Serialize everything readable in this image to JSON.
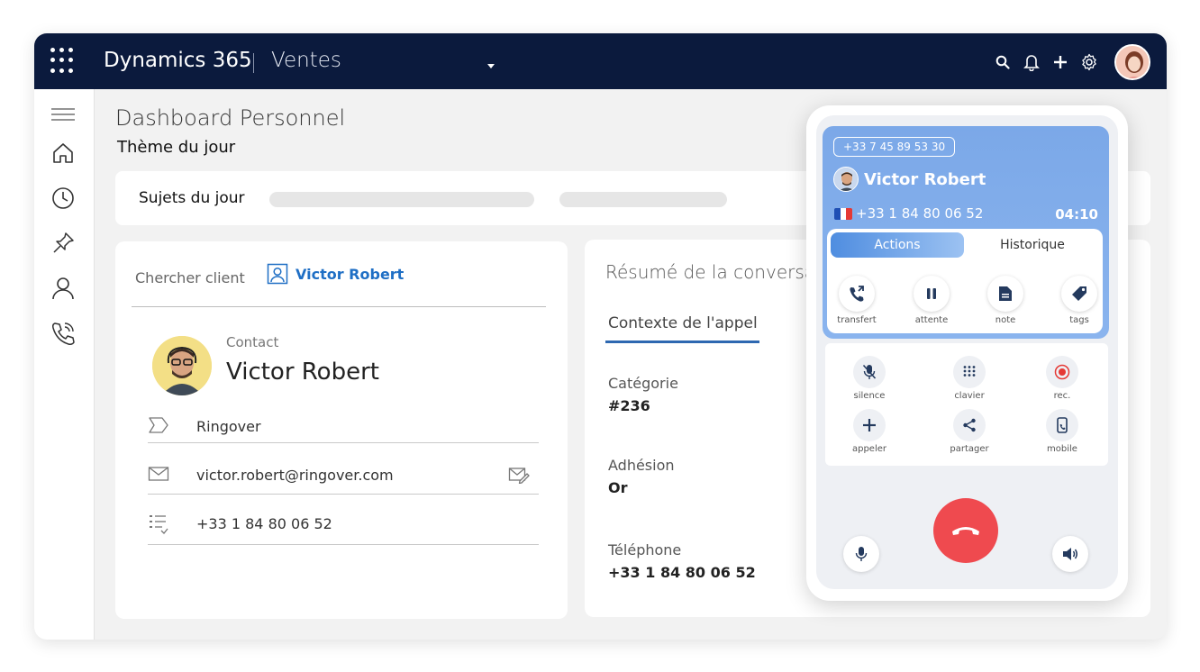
{
  "app": {
    "brand": "Dynamics 365",
    "module": "Ventes"
  },
  "page": {
    "title": "Dashboard Personnel",
    "subtitle": "Thème du jour",
    "topics_label": "Sujets du jour"
  },
  "client_card": {
    "search_label": "Chercher client",
    "selected_client": "Victor Robert",
    "contact_kind": "Contact",
    "contact_name": "Victor Robert",
    "company": "Ringover",
    "email": "victor.robert@ringover.com",
    "phone": "+33 1 84 80 06 52"
  },
  "conversation": {
    "title": "Résumé de la conversa",
    "tab": "Contexte de l'appel",
    "fields": [
      {
        "label": "Catégorie",
        "value": "#236"
      },
      {
        "label": "Adhésion",
        "value": "Or"
      },
      {
        "label": "Téléphone",
        "value": "+33 1 84 80 06 52"
      }
    ]
  },
  "call": {
    "line_number": "+33 7 45 89 53 30",
    "caller_name": "Victor Robert",
    "caller_phone": "+33 1 84 80 06 52",
    "duration": "04:10",
    "tabs": {
      "active": "Actions",
      "other": "Historique"
    },
    "actions": [
      {
        "label": "transfert",
        "icon": "transfer-call-icon"
      },
      {
        "label": "attente",
        "icon": "pause-icon"
      },
      {
        "label": "note",
        "icon": "note-icon"
      },
      {
        "label": "tags",
        "icon": "tag-icon"
      }
    ],
    "controls": [
      {
        "label": "silence",
        "icon": "mic-off-icon"
      },
      {
        "label": "clavier",
        "icon": "keypad-icon"
      },
      {
        "label": "rec.",
        "icon": "record-icon"
      },
      {
        "label": "appeler",
        "icon": "plus-icon"
      },
      {
        "label": "partager",
        "icon": "share-icon"
      },
      {
        "label": "mobile",
        "icon": "mobile-icon"
      }
    ]
  },
  "colors": {
    "topbar": "#0b1a3d",
    "accent": "#1f6fc5",
    "hangup": "#ef4a4f",
    "record": "#e53935"
  }
}
